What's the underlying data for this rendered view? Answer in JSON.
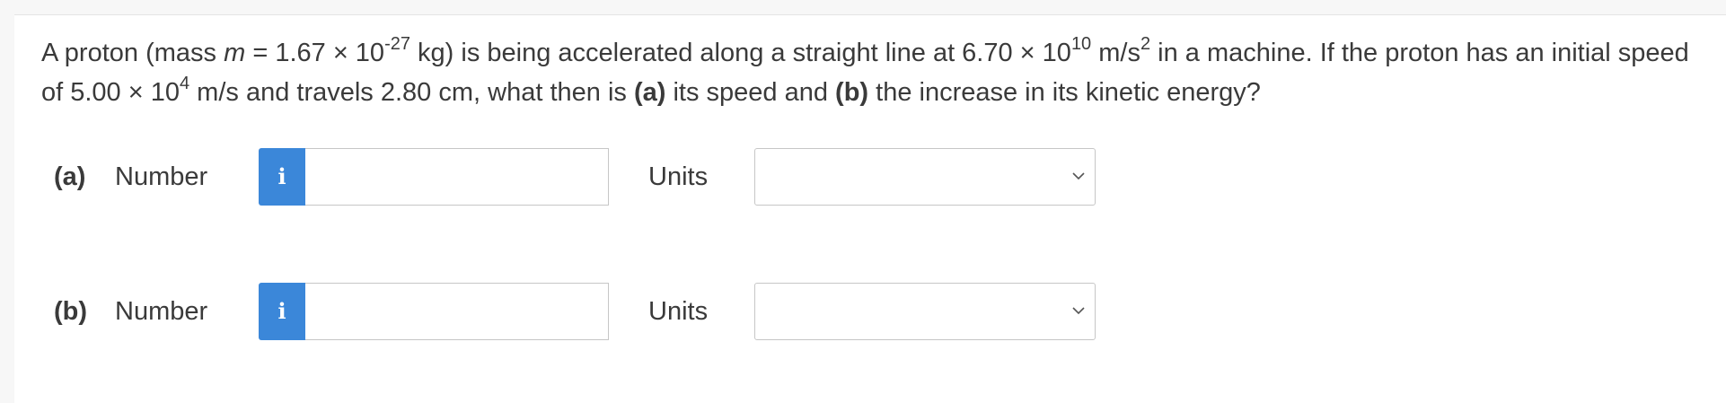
{
  "question": {
    "t1": "A proton (mass ",
    "var_m": "m",
    "t2": " = 1.67 × 10",
    "sup1": "-27",
    "t3": " kg) is being accelerated along a straight line at 6.70 × 10",
    "sup2": "10",
    "t4": " m/s",
    "sup3": "2",
    "t5": " in a machine. If the proton has an initial speed of 5.00 × 10",
    "sup4": "4",
    "t6": " m/s and travels 2.80 cm, what then is ",
    "bold_a": "(a)",
    "t7": " its speed and ",
    "bold_b": "(b)",
    "t8": " the increase in its kinetic energy?"
  },
  "parts": {
    "a": {
      "label": "(a)",
      "number_label": "Number",
      "info_glyph": "i",
      "number_value": "",
      "units_label": "Units",
      "units_value": ""
    },
    "b": {
      "label": "(b)",
      "number_label": "Number",
      "info_glyph": "i",
      "number_value": "",
      "units_label": "Units",
      "units_value": ""
    }
  },
  "icons": {
    "info": "info-icon",
    "dropdown": "chevron-down-icon"
  },
  "colors": {
    "info_button": "#3b87d9",
    "text": "#3a3a3a",
    "border": "#c6c6c6"
  }
}
